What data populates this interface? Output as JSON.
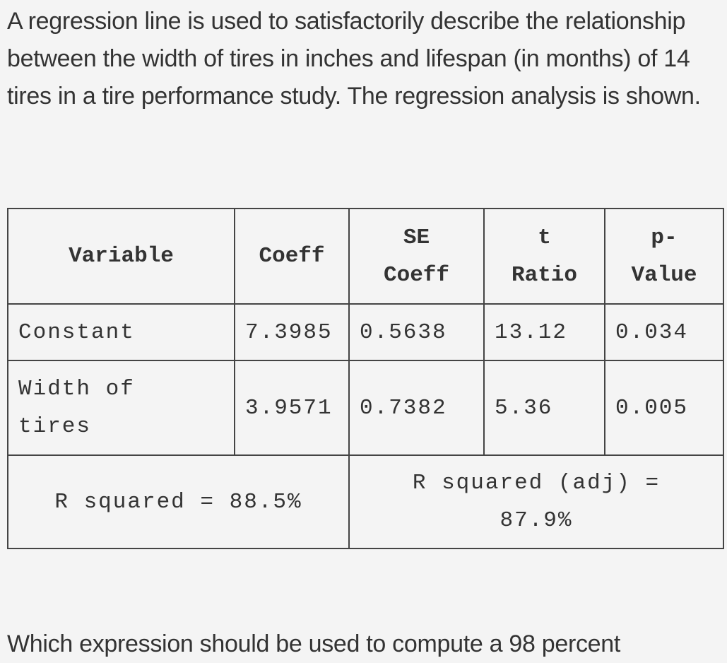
{
  "intro_text": "A regression line is used to satisfactorily describe the relationship between the width of tires in inches and lifespan (in months) of 14 tires in a tire performance study. The regression analysis is shown.",
  "table": {
    "headers": {
      "variable": "Variable",
      "coeff": "Coeff",
      "se_coeff_line1": "SE",
      "se_coeff_line2": "Coeff",
      "t_ratio_line1": "t",
      "t_ratio_line2": "Ratio",
      "p_value_line1": "p-",
      "p_value_line2": "Value"
    },
    "rows": [
      {
        "variable": "Constant",
        "coeff": "7.3985",
        "se_coeff": "0.5638",
        "t_ratio": "13.12",
        "p_value": "0.034"
      },
      {
        "variable_line1": "Width of",
        "variable_line2": "tires",
        "coeff": "3.9571",
        "se_coeff": "0.7382",
        "t_ratio": "5.36",
        "p_value": "0.005"
      }
    ],
    "r_squared": "R squared = 88.5%",
    "r_squared_adj_line1": "R squared (adj) =",
    "r_squared_adj_line2": "87.9%"
  },
  "question_text": "Which expression should be used to compute a 98 percent"
}
